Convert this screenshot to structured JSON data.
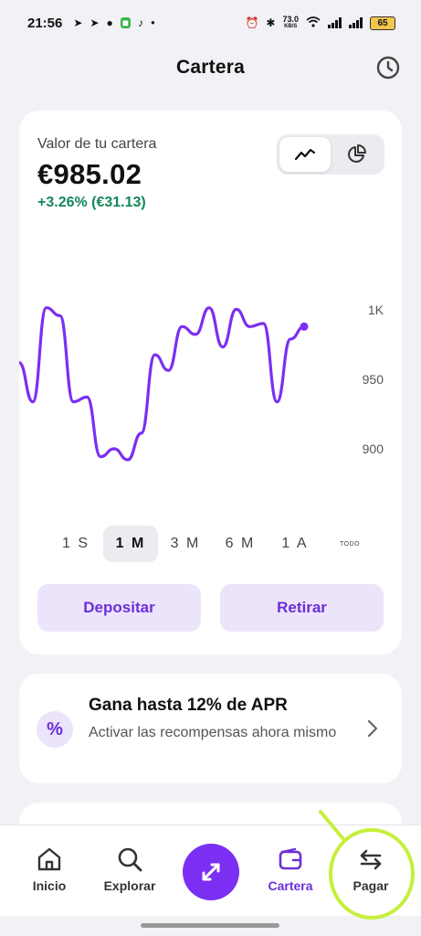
{
  "status_bar": {
    "time": "21:56",
    "net_speed_value": "73.0",
    "net_speed_unit": "KB/S",
    "battery": "65"
  },
  "header": {
    "title": "Cartera",
    "history_icon": "clock-icon"
  },
  "portfolio": {
    "label": "Valor de tu cartera",
    "value": "€985.02",
    "change": "+3.26% (€31.13)",
    "toggle_line_icon": "line-chart-icon",
    "toggle_pie_icon": "pie-chart-icon"
  },
  "chart_data": {
    "type": "line",
    "title": "",
    "xlabel": "",
    "ylabel": "",
    "y_ticks": [
      "1K",
      "950",
      "900"
    ],
    "ylim": [
      870,
      1010
    ],
    "series": [
      {
        "color": "#7b2ff2",
        "values": [
          960,
          935,
          995,
          990,
          935,
          938,
          900,
          905,
          898,
          915,
          965,
          955,
          983,
          978,
          995,
          970,
          994,
          983,
          985,
          935,
          975,
          983
        ]
      }
    ],
    "last_point_marker": true
  },
  "periods": {
    "items": [
      "1 S",
      "1 M",
      "3 M",
      "6 M",
      "1 A",
      "TODO"
    ],
    "active": "1 M"
  },
  "actions": {
    "deposit": "Depositar",
    "withdraw": "Retirar"
  },
  "promo": {
    "icon_text": "%",
    "title": "Gana hasta 12% de APR",
    "subtitle": "Activar las recompensas ahora mismo"
  },
  "nav": {
    "home": "Inicio",
    "explore": "Explorar",
    "portfolio": "Cartera",
    "pay": "Pagar"
  },
  "colors": {
    "accent": "#7b2ff2",
    "positive": "#14875a",
    "annotation": "#c6ef3a"
  }
}
